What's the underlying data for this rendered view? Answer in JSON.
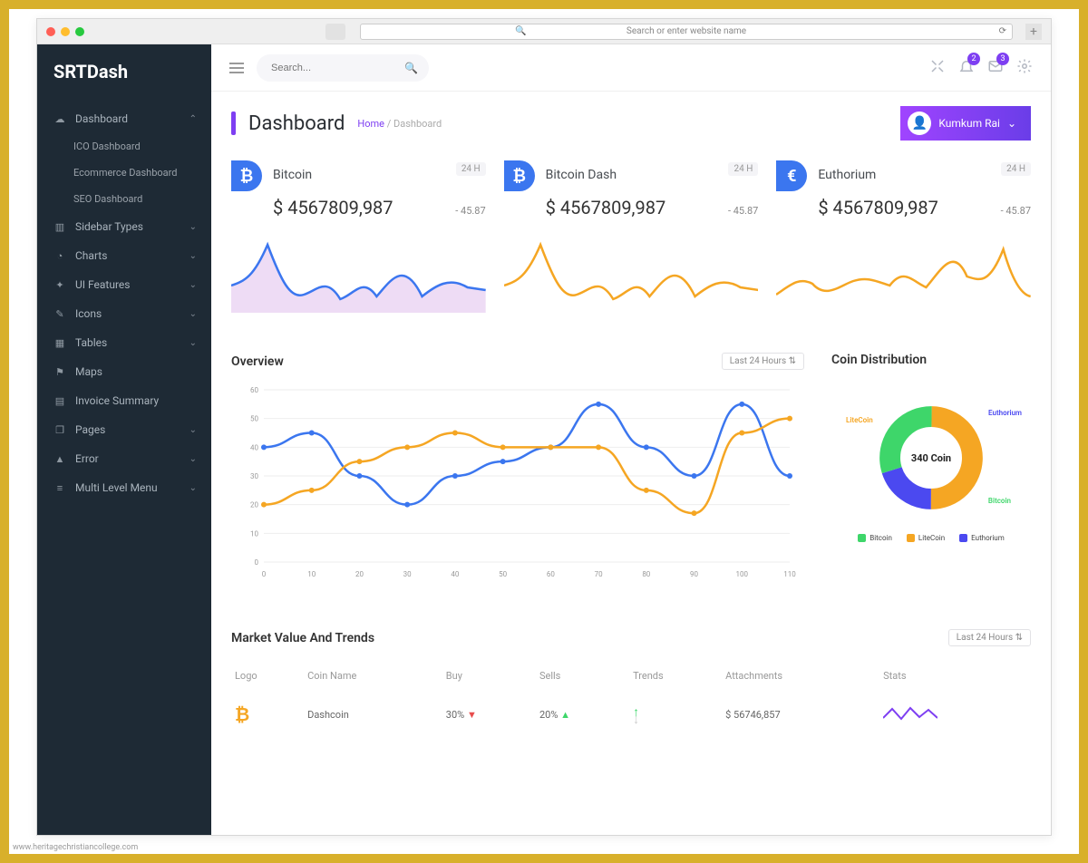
{
  "browser": {
    "url_placeholder": "Search or enter website name"
  },
  "app_name": "SRTDash",
  "search_placeholder": "Search...",
  "notifications": {
    "bell": "2",
    "mail": "3"
  },
  "page_title": "Dashboard",
  "breadcrumb": {
    "home": "Home",
    "current": "Dashboard",
    "sep": "/"
  },
  "user": {
    "name": "Kumkum Rai"
  },
  "sidebar": {
    "items": [
      {
        "label": "Dashboard",
        "icon": "☁",
        "expanded": true,
        "children": [
          {
            "label": "ICO Dashboard"
          },
          {
            "label": "Ecommerce Dashboard"
          },
          {
            "label": "SEO Dashboard"
          }
        ]
      },
      {
        "label": "Sidebar Types",
        "icon": "▥"
      },
      {
        "label": "Charts",
        "icon": "◔"
      },
      {
        "label": "UI Features",
        "icon": "✦"
      },
      {
        "label": "Icons",
        "icon": "✎"
      },
      {
        "label": "Tables",
        "icon": "▦"
      },
      {
        "label": "Maps",
        "icon": "⚑"
      },
      {
        "label": "Invoice Summary",
        "icon": "▤"
      },
      {
        "label": "Pages",
        "icon": "❐"
      },
      {
        "label": "Error",
        "icon": "▲"
      },
      {
        "label": "Multi Level Menu",
        "icon": "≡"
      }
    ]
  },
  "cards": [
    {
      "name": "Bitcoin",
      "symbol": "₿",
      "period": "24 H",
      "value": "$ 4567809,987",
      "change": "- 45.87",
      "color": "#3b76ef",
      "fill": "#eedcf5"
    },
    {
      "name": "Bitcoin Dash",
      "symbol": "₿",
      "period": "24 H",
      "value": "$ 4567809,987",
      "change": "- 45.87",
      "color": "#f5a623",
      "fill": "none"
    },
    {
      "name": "Euthorium",
      "symbol": "€",
      "period": "24 H",
      "value": "$ 4567809,987",
      "change": "- 45.87",
      "color": "#f5a623",
      "fill": "none"
    }
  ],
  "overview": {
    "title": "Overview",
    "picker": "Last 24 Hours"
  },
  "distribution": {
    "title": "Coin Distribution",
    "center": "340 Coin",
    "labels": {
      "lite": "LiteCoin",
      "euth": "Euthorium",
      "btc": "Bitcoin"
    },
    "legend": [
      {
        "label": "Bitcoin",
        "color": "#3ed66a"
      },
      {
        "label": "LiteCoin",
        "color": "#f5a623"
      },
      {
        "label": "Euthorium",
        "color": "#4b49f0"
      }
    ]
  },
  "market": {
    "title": "Market Value And Trends",
    "picker": "Last 24 Hours",
    "headers": {
      "logo": "Logo",
      "coin": "Coin Name",
      "buy": "Buy",
      "sells": "Sells",
      "trends": "Trends",
      "attach": "Attachments",
      "stats": "Stats"
    },
    "rows": [
      {
        "logo": "₿",
        "coin": "Dashcoin",
        "buy": "30%",
        "buy_dir": "down",
        "sells": "20%",
        "sells_dir": "up",
        "attach": "$ 56746,857"
      }
    ]
  },
  "footer_note": "www.heritagechristiancollege.com",
  "chart_data": {
    "overview": {
      "type": "line",
      "x": [
        0,
        10,
        20,
        30,
        40,
        50,
        60,
        70,
        80,
        90,
        100,
        110
      ],
      "series": [
        {
          "name": "blue",
          "color": "#3b76ef",
          "values": [
            40,
            45,
            30,
            20,
            30,
            35,
            40,
            55,
            40,
            30,
            55,
            30
          ]
        },
        {
          "name": "amber",
          "color": "#f5a623",
          "values": [
            20,
            25,
            35,
            40,
            45,
            40,
            40,
            40,
            25,
            17,
            45,
            50
          ]
        }
      ],
      "ylim": [
        0,
        60
      ],
      "y_ticks": [
        0,
        10,
        20,
        30,
        40,
        50,
        60
      ],
      "x_ticks": [
        0,
        10,
        20,
        30,
        40,
        50,
        60,
        70,
        80,
        90,
        100,
        110
      ]
    },
    "donut": {
      "type": "pie",
      "total_label": "340 Coin",
      "slices": [
        {
          "name": "Euthorium",
          "value": 20,
          "color": "#4b49f0"
        },
        {
          "name": "Bitcoin",
          "value": 30,
          "color": "#3ed66a"
        },
        {
          "name": "LiteCoin",
          "value": 50,
          "color": "#f5a623"
        }
      ]
    },
    "sparklines": {
      "type": "line",
      "cards": [
        {
          "values": [
            40,
            45,
            90,
            50,
            30,
            55,
            20,
            50,
            25,
            70,
            40,
            55
          ],
          "color": "#3b76ef",
          "fill": "#eedcf5"
        },
        {
          "values": [
            40,
            45,
            90,
            50,
            30,
            55,
            20,
            50,
            25,
            70,
            40,
            55
          ],
          "color": "#f5a623",
          "fill": "none"
        },
        {
          "values": [
            30,
            40,
            55,
            35,
            50,
            40,
            60,
            45,
            90,
            45,
            50,
            85,
            40
          ],
          "color": "#f5a623",
          "fill": "none"
        }
      ]
    }
  }
}
